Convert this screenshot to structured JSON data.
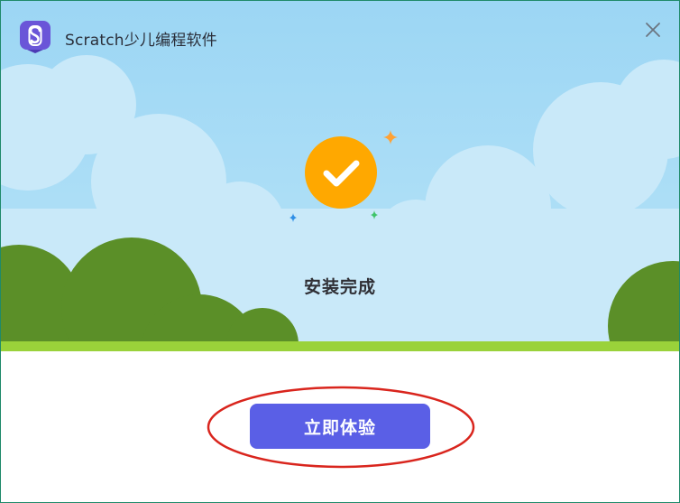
{
  "window": {
    "title": "Scratch少儿编程软件",
    "close_icon": "close-icon",
    "logo_icon": "scratch-logo-icon"
  },
  "status": {
    "icon": "checkmark-icon",
    "text": "安装完成"
  },
  "actions": {
    "start_label": "立即体验"
  },
  "colors": {
    "sky": "#a8dcf5",
    "cloud": "#cbeaf9",
    "hill": "#5a8f27",
    "grass": "#9bd23a",
    "badge": "#ffa800",
    "button": "#5a5fe6",
    "logo": "#6a55d8",
    "highlight": "#d9251d"
  }
}
